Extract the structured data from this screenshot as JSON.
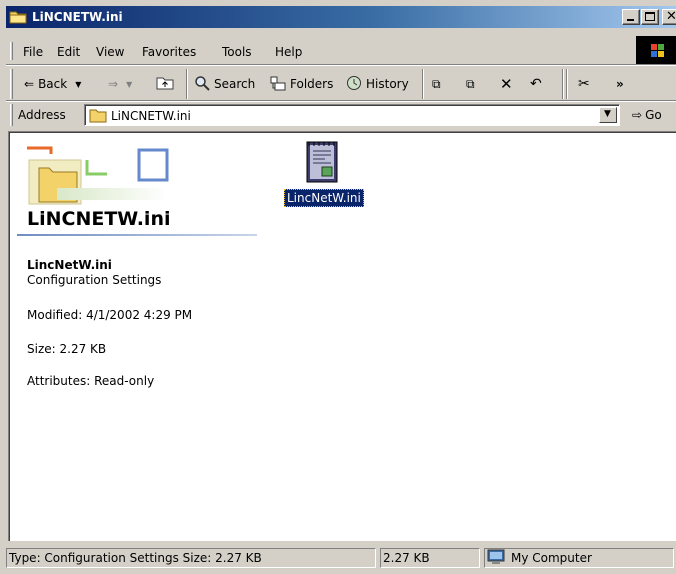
{
  "window": {
    "title": "LiNCNETW.ini"
  },
  "menu": {
    "items": [
      {
        "label": "File",
        "hotkey": "F"
      },
      {
        "label": "Edit",
        "hotkey": "E"
      },
      {
        "label": "View",
        "hotkey": "V"
      },
      {
        "label": "Favorites",
        "hotkey": "a"
      },
      {
        "label": "Tools",
        "hotkey": "T"
      },
      {
        "label": "Help",
        "hotkey": "H"
      }
    ]
  },
  "toolbar": {
    "back": "Back",
    "search": "Search",
    "folders": "Folders",
    "history": "History"
  },
  "address": {
    "label": "Address",
    "value": "LiNCNETW.ini",
    "go": "Go"
  },
  "panel": {
    "title": "LiNCNETW.ini",
    "file_name": "LincNetW.ini",
    "file_type": "Configuration Settings",
    "modified": "Modified: 4/1/2002 4:29 PM",
    "size": "Size: 2.27 KB",
    "attributes": "Attributes: Read-only"
  },
  "file_item": {
    "label": "LincNetW.ini"
  },
  "status": {
    "description": "Type: Configuration Settings Size: 2.27 KB",
    "size": "2.27 KB",
    "zone": "My Computer"
  },
  "icons": [
    "folder-icon",
    "minimize-icon",
    "maximize-icon",
    "close-icon",
    "windows-logo-icon",
    "back-arrow-icon",
    "forward-arrow-icon",
    "up-folder-icon",
    "search-icon",
    "folders-icon",
    "history-icon",
    "move-to-icon",
    "copy-to-icon",
    "delete-icon",
    "undo-icon",
    "cut-icon",
    "go-arrow-icon",
    "ini-file-icon",
    "computer-icon"
  ],
  "colors": {
    "titlebar_start": "#0a246a",
    "titlebar_end": "#a6caf0",
    "selection": "#0a246a",
    "chrome": "#d4d0c8"
  }
}
